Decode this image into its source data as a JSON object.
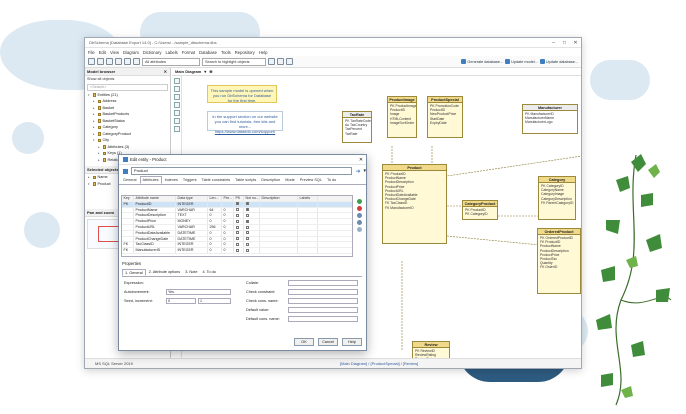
{
  "app": {
    "title": "DbSchema [Database Export 14.0] - C:/Users/.../sample_dbschema.dbs",
    "menu": [
      "File",
      "Edit",
      "View",
      "Diagram",
      "Dictionary",
      "Labels",
      "Format",
      "Database",
      "Tools",
      "Repository",
      "Help"
    ],
    "toolbar": {
      "filter_select": "All attributes",
      "search_select": "Search to highlight objects",
      "links": [
        "Generate database...",
        "Update model...",
        "Update database..."
      ]
    },
    "window_controls": [
      "–",
      "□",
      "✕"
    ]
  },
  "left_pane": {
    "title": "Model browser",
    "show_all": "Show all objects",
    "search_placeholder": "<Search>",
    "tree": [
      {
        "label": "Entities (21)",
        "level": 0,
        "expanded": true
      },
      {
        "label": "Address",
        "level": 1
      },
      {
        "label": "Basket",
        "level": 1
      },
      {
        "label": "BasketProducts",
        "level": 1
      },
      {
        "label": "BasketStatus",
        "level": 1
      },
      {
        "label": "Category",
        "level": 1
      },
      {
        "label": "CategoryProduct",
        "level": 1
      },
      {
        "label": "City",
        "level": 1,
        "expanded": true
      },
      {
        "label": "Attributes (3)",
        "level": 2
      },
      {
        "label": "Keys (1)",
        "level": 2
      },
      {
        "label": "Relationships (1)",
        "level": 2
      }
    ],
    "sections": [
      "Selected objects",
      "Pan and zoom"
    ],
    "selected_items": [
      "Name",
      "Product"
    ]
  },
  "main": {
    "tab": "Main Diagram",
    "note_yellow": "This sample model is opened when you run DbSchema for Database for the first time.",
    "note_info": "In the support section on our website you can find tutorials, free kits and more...",
    "note_link": "https://www.dataedo.com/support/",
    "status": "MS SQL Server 2019",
    "breadcrumb": "[Main Diagram] / [ProductSpecial] / [Review]",
    "entities": [
      {
        "id": "taxrate",
        "name": "TaxRate",
        "fields": [
          "PK TaxRateCode",
          "Au TaxCountry",
          "TaxPercent",
          "TaxRate"
        ],
        "style": "white"
      },
      {
        "id": "productimage",
        "name": "ProductImage",
        "fields": [
          "PK ProductImageID",
          "ProductID",
          "Image",
          "HTMLContent",
          "ImageSortOrder"
        ],
        "style": "yellow"
      },
      {
        "id": "productspecial",
        "name": "ProductSpecial",
        "fields": [
          "PK PromotionCode",
          "ProductID",
          "NewProductPrice",
          "StartDate",
          "ExpiryDate"
        ],
        "style": "yellow"
      },
      {
        "id": "product",
        "name": "Product",
        "fields": [
          "PK ProductID",
          "ProductName",
          "ProductDescription",
          "ProductPrice",
          "ProductURL",
          "ProductDateAvailable",
          "ProductChangeDate",
          "FK TaxClassID",
          "FK ManufacturerID"
        ],
        "style": "yellow"
      },
      {
        "id": "categoryproduct",
        "name": "CategoryProduct",
        "fields": [
          "PK ProductID",
          "PK CategoryID"
        ],
        "style": "yellow"
      },
      {
        "id": "manufacturer",
        "name": "Manufacturer",
        "fields": [
          "PK ManufacturerID",
          "ManufacturerName",
          "ManufacturerLogo"
        ],
        "style": "white"
      },
      {
        "id": "category",
        "name": "Category",
        "fields": [
          "PK CategoryID",
          "CategoryName",
          "CategoryImage",
          "CategoryDescription",
          "FK ParentCategoryID"
        ],
        "style": "yellow"
      },
      {
        "id": "orderedproduct",
        "name": "OrderedProduct",
        "fields": [
          "PK OrderedProductID",
          "FK ProductID",
          "ProductName",
          "ProductDescription",
          "ProductPrice",
          "ProductTax",
          "Quantity",
          "FK OrderID"
        ],
        "style": "yellow"
      },
      {
        "id": "review",
        "name": "Review",
        "fields": [
          "PK ReviewID",
          "ReviewRating",
          "ReviewStatus"
        ],
        "style": "yellow"
      }
    ]
  },
  "dialog": {
    "title": "Edit entity - Product",
    "entity_name": "Product",
    "tabs": [
      "General",
      "Attributes",
      "Indexes",
      "Triggers",
      "Table constraints",
      "Table scripts",
      "Description",
      "Mode",
      "Preview SQL",
      "To do"
    ],
    "active_tab": "Attributes",
    "columns": [
      "Key",
      "Attribute name",
      "Data type",
      "Len...",
      "Pre...",
      "PK",
      "Not nu...",
      "Description",
      "Labels"
    ],
    "rows": [
      {
        "key": "PK",
        "name": "ProductID",
        "type": "INTEGER",
        "len": "",
        "pre": "",
        "pk": true,
        "nn": true,
        "sel": true
      },
      {
        "key": "",
        "name": "ProductName",
        "type": "VARCHAR",
        "len": "64",
        "pre": "0",
        "pk": false,
        "nn": true
      },
      {
        "key": "",
        "name": "ProductDescription",
        "type": "TEXT",
        "len": "0",
        "pre": "0",
        "pk": false,
        "nn": false
      },
      {
        "key": "",
        "name": "ProductPrice",
        "type": "MONEY",
        "len": "0",
        "pre": "0",
        "pk": false,
        "nn": true
      },
      {
        "key": "",
        "name": "ProductURL",
        "type": "VARCHAR",
        "len": "256",
        "pre": "0",
        "pk": false,
        "nn": false
      },
      {
        "key": "",
        "name": "ProductDateAvailable",
        "type": "DATETIME",
        "len": "0",
        "pre": "0",
        "pk": false,
        "nn": false
      },
      {
        "key": "",
        "name": "ProductChangeDate",
        "type": "DATETIME",
        "len": "0",
        "pre": "0",
        "pk": false,
        "nn": false
      },
      {
        "key": "FK",
        "name": "TaxClassID",
        "type": "INTEGER",
        "len": "0",
        "pre": "0",
        "pk": false,
        "nn": false
      },
      {
        "key": "FK",
        "name": "ManufacturerID",
        "type": "INTEGER",
        "len": "0",
        "pre": "0",
        "pk": false,
        "nn": false
      }
    ],
    "properties_label": "Properties",
    "prop_tabs": [
      "1. General",
      "2. Attribute options",
      "3. Note",
      "4. To do"
    ],
    "form": {
      "expression_label": "Expression:",
      "autoincrement_label": "Autoincrement:",
      "autoincrement_value": "Yes",
      "seed_label": "Seed, increment:",
      "seed_value": "0",
      "increment_value": "1",
      "collate_label": "Collate:",
      "check_constraint_label": "Check constraint:",
      "check_cons_name_label": "Check cons. name:",
      "default_value_label": "Default value:",
      "default_cons_name_label": "Default cons. name:"
    },
    "buttons": {
      "ok": "OK",
      "cancel": "Cancel",
      "help": "Help"
    }
  }
}
